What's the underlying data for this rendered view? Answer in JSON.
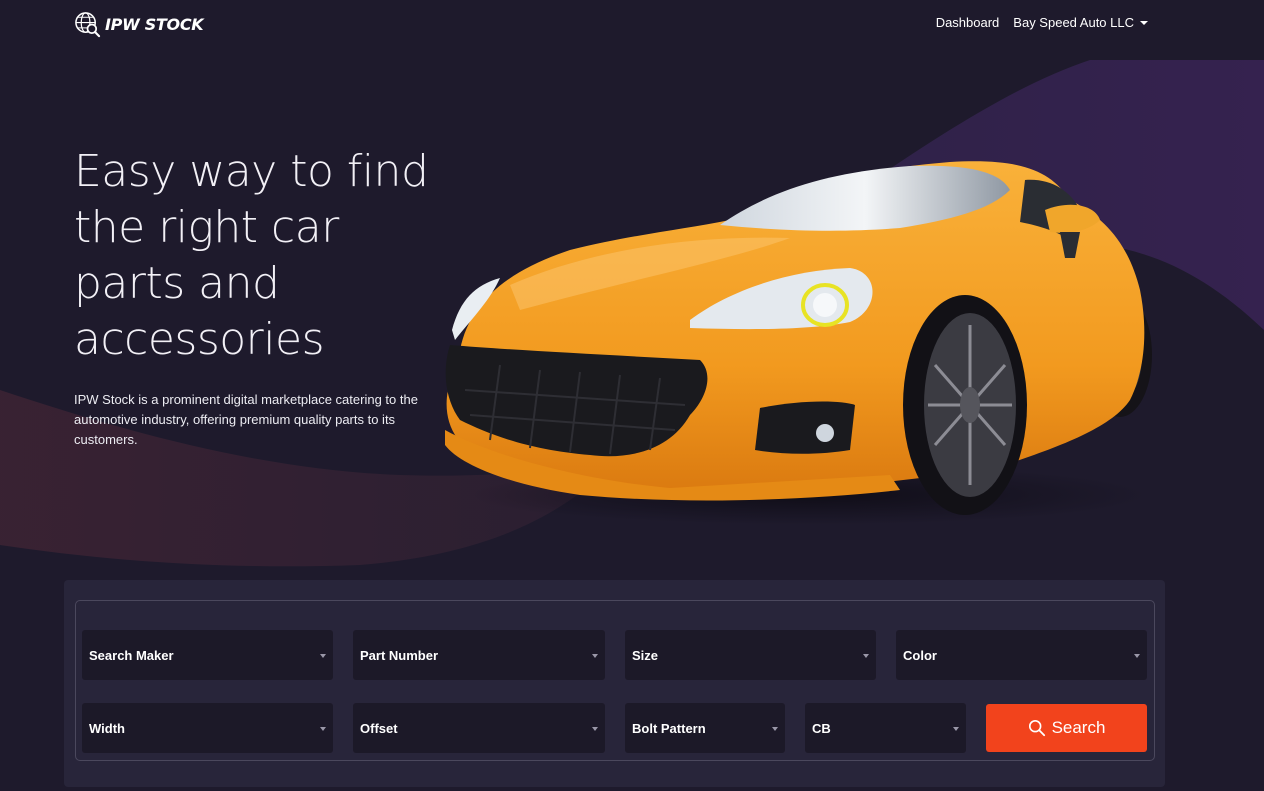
{
  "nav": {
    "logo_text": "IPW STOCK",
    "links": [
      {
        "label": "Dashboard"
      },
      {
        "label": "Bay Speed Auto LLC"
      }
    ]
  },
  "hero": {
    "title": "Easy way to find the right car parts and accessories",
    "description": "IPW Stock is a prominent digital marketplace catering to the automotive industry, offering premium quality parts to its customers."
  },
  "search": {
    "fields": {
      "maker": "Search Maker",
      "part_number": "Part Number",
      "size": "Size",
      "color": "Color",
      "width": "Width",
      "offset": "Offset",
      "bolt_pattern": "Bolt Pattern",
      "cb": "CB"
    },
    "button_label": "Search"
  },
  "colors": {
    "background": "#1e1a2c",
    "panel": "#28253a",
    "field": "#1c1928",
    "accent": "#f2431c",
    "car_body": "#f5a023"
  }
}
